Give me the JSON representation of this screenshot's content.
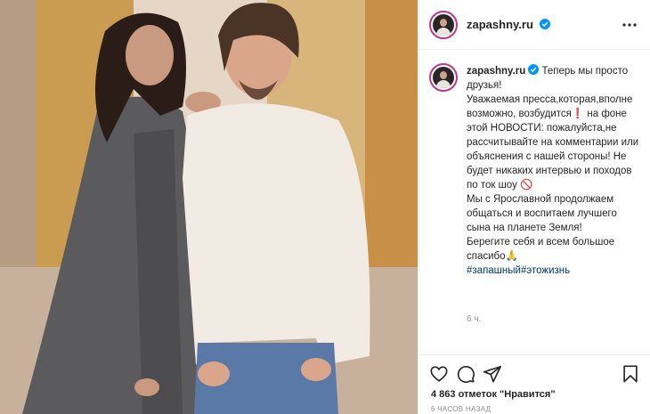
{
  "post": {
    "username": "zapashny.ru",
    "verified": true,
    "caption_lines": [
      "Теперь мы просто друзья!",
      "Уважаемая пресса,которая,вполне возможно, возбудится❗ на фоне этой НОВОСТИ: пожалуйста,не рассчитывайте на комментарии или объяснения с нашей стороны! Не будет никаких интервью и походов по ток шоу 🚫",
      "Мы с Ярославной продолжаем общаться и воспитаем лучшего сына на планете Земля!",
      "Берегите себя и всем большое спасибо🙏"
    ],
    "hashtags": [
      "#запашный",
      "#этожизнь"
    ],
    "comment_time": "6 ч.",
    "likes_text": "4 863 отметок \"Нравится\"",
    "posted_ago": "6 часов назад"
  },
  "icons": {
    "more": "more-icon",
    "like": "heart-icon",
    "comment": "comment-icon",
    "share": "share-icon",
    "save": "bookmark-icon",
    "verified": "verified-badge-icon"
  },
  "colors": {
    "verified_blue": "#0095f6",
    "hashtag": "#00376b",
    "story_ring": "#c13584",
    "muted": "#8e8e8e"
  }
}
